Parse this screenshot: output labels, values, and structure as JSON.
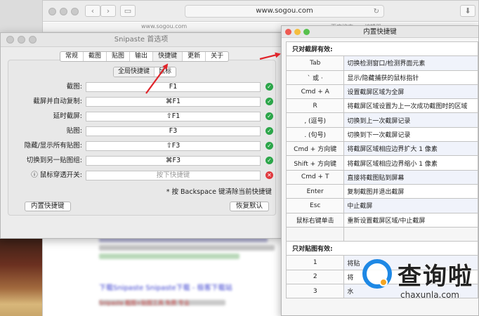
{
  "safari": {
    "address": "www.sogou.com",
    "reload_icon": "reload-icon",
    "strip_left": "www.sogou.com",
    "strip_right": "百度搜索——编辑器",
    "results": [
      {
        "title": "下载Snipaste Snipaste下载 - 极客下载站"
      },
      {
        "title": "Snipaste 截图+贴图工具 免费 专业"
      }
    ]
  },
  "prefs": {
    "title": "Snipaste 首选项",
    "tabs": [
      {
        "label": "常规"
      },
      {
        "label": "截图"
      },
      {
        "label": "贴图"
      },
      {
        "label": "输出"
      },
      {
        "label": "快捷键"
      },
      {
        "label": "更新"
      },
      {
        "label": "关于"
      }
    ],
    "active_tab": "快捷键",
    "subtabs": [
      {
        "label": "全局快捷键"
      },
      {
        "label": "鼠标"
      }
    ],
    "hotkeys": [
      {
        "label": "截图:",
        "value": "F1",
        "status": "ok"
      },
      {
        "label": "截屏并自动复制:",
        "value": "⌘F1",
        "status": "ok"
      },
      {
        "label": "延时截屏:",
        "value": "⇧F1",
        "status": "ok"
      },
      {
        "label": "贴图:",
        "value": "F3",
        "status": "ok"
      },
      {
        "label": "隐藏/显示所有贴图:",
        "value": "⇧F3",
        "status": "ok"
      },
      {
        "label": "切换到另一贴图组:",
        "value": "⌘F3",
        "status": "ok"
      },
      {
        "label": "ⓘ 鼠标穿透开关:",
        "value": "按下快捷键",
        "status": "err"
      }
    ],
    "note": "* 按 Backspace 键清除当前快捷键",
    "builtin_button": "内置快捷键",
    "restore_button": "恢复默认"
  },
  "builtin": {
    "title": "内置快捷键",
    "section_screenshot": "只对截屏有效:",
    "rows": [
      {
        "key": "Tab",
        "desc": "切换检测窗口/检测界面元素"
      },
      {
        "key": "` 或 ·",
        "desc": "显示/隐藏捕获的鼠标指针"
      },
      {
        "key": "Cmd + A",
        "desc": "设置截屏区域为全屏"
      },
      {
        "key": "R",
        "desc": "将截屏区域设置为上一次成功截图时的区域"
      },
      {
        "key": ", (逗号)",
        "desc": "切换到上一次截屏记录"
      },
      {
        "key": ". (句号)",
        "desc": "切换到下一次截屏记录"
      },
      {
        "key": "Cmd + 方向键",
        "desc": "将截屏区域相应边界扩大 1 像素"
      },
      {
        "key": "Shift + 方向键",
        "desc": "将截屏区域相应边界缩小 1 像素"
      },
      {
        "key": "Cmd + T",
        "desc": "直接将截图贴到屏幕"
      },
      {
        "key": "Enter",
        "desc": "复制截图并退出截屏"
      },
      {
        "key": "Esc",
        "desc": "中止截屏"
      },
      {
        "key": "鼠标右键单击",
        "desc": "重新设置截屏区域/中止截屏"
      }
    ],
    "section_pin": "只对贴图有效:",
    "pin_rows": [
      {
        "key": "1",
        "desc": "将贴"
      },
      {
        "key": "2",
        "desc": "将"
      },
      {
        "key": "3",
        "desc": "水"
      }
    ]
  },
  "watermark": {
    "brand": "查询啦",
    "url": "chaxunla.com"
  },
  "colors": {
    "accent_red": "#e0242a",
    "ok_green": "#2ca64a",
    "err_red": "#e0393e",
    "link_blue": "#3a3fcf",
    "brand_blue": "#1e88e5",
    "brand_orange": "#f5a623"
  }
}
